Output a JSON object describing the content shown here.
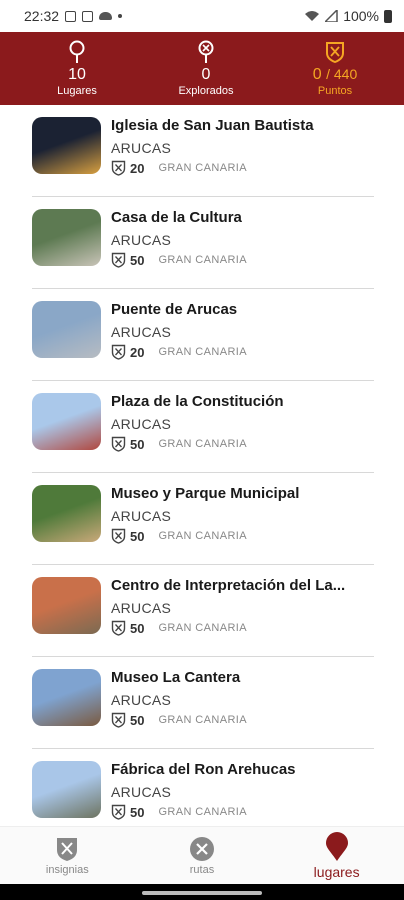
{
  "status": {
    "time": "22:32",
    "battery": "100%"
  },
  "header": {
    "places": {
      "value": "10",
      "label": "Lugares",
      "icon": "pin-icon"
    },
    "explored": {
      "value": "0",
      "label": "Explorados",
      "icon": "explored-pin-icon"
    },
    "points": {
      "value": "0",
      "total": "/ 440",
      "label": "Puntos",
      "icon": "shield-icon"
    }
  },
  "places": [
    {
      "name": "Iglesia de San Juan Bautista",
      "city": "ARUCAS",
      "points": "20",
      "region": "GRAN CANARIA",
      "thumb": [
        "#1b2233",
        "#d8a040"
      ]
    },
    {
      "name": "Casa de la Cultura",
      "city": "ARUCAS",
      "points": "50",
      "region": "GRAN CANARIA",
      "thumb": [
        "#5d7a52",
        "#c9c4b8"
      ]
    },
    {
      "name": "Puente de Arucas",
      "city": "ARUCAS",
      "points": "20",
      "region": "GRAN CANARIA",
      "thumb": [
        "#8aa7c7",
        "#b7bcc2"
      ]
    },
    {
      "name": "Plaza de la Constitución",
      "city": "ARUCAS",
      "points": "50",
      "region": "GRAN CANARIA",
      "thumb": [
        "#aac8ea",
        "#b0473e"
      ]
    },
    {
      "name": "Museo y Parque Municipal",
      "city": "ARUCAS",
      "points": "50",
      "region": "GRAN CANARIA",
      "thumb": [
        "#4f7a3a",
        "#caa97a"
      ]
    },
    {
      "name": "Centro de Interpretación del La...",
      "city": "ARUCAS",
      "points": "50",
      "region": "GRAN CANARIA",
      "thumb": [
        "#c9704a",
        "#7b6a52"
      ]
    },
    {
      "name": "Museo La Cantera",
      "city": "ARUCAS",
      "points": "50",
      "region": "GRAN CANARIA",
      "thumb": [
        "#7fa3d0",
        "#7a5a40"
      ]
    },
    {
      "name": "Fábrica del Ron Arehucas",
      "city": "ARUCAS",
      "points": "50",
      "region": "GRAN CANARIA",
      "thumb": [
        "#a9c6e8",
        "#6d7360"
      ]
    }
  ],
  "nav": {
    "badges": {
      "label": "insignias",
      "icon": "badge-shield-icon"
    },
    "routes": {
      "label": "rutas",
      "icon": "routes-icon"
    },
    "places": {
      "label": "lugares",
      "icon": "map-pin-icon"
    }
  },
  "colors": {
    "brand": "#8b1a1c",
    "accent": "#f5a623"
  }
}
